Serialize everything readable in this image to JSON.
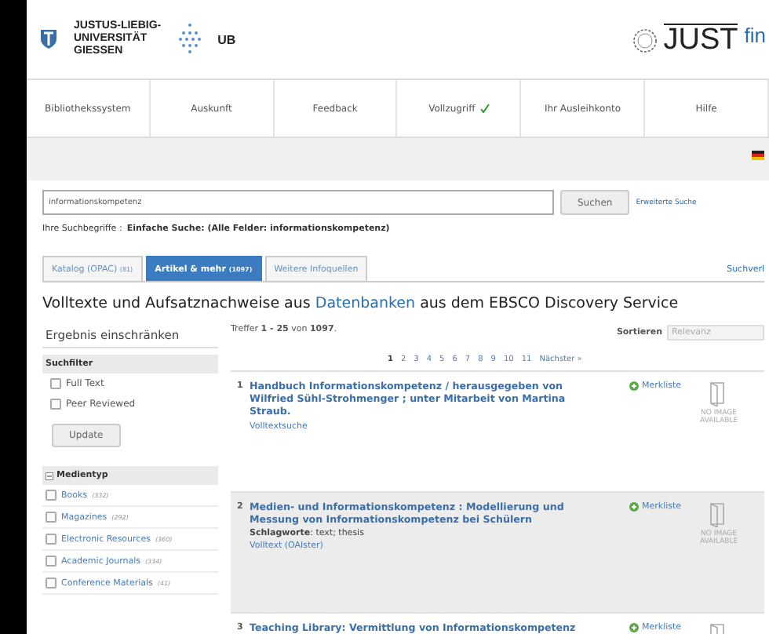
{
  "header": {
    "university": [
      "JUSTUS-LIEBIG-",
      "UNIVERSITÄT",
      "GIESSEN"
    ],
    "library": "UB",
    "brand": "JUST",
    "brand_suffix": "fin"
  },
  "nav": [
    {
      "label": "Bibliothekssystem",
      "checked": false
    },
    {
      "label": "Auskunft",
      "checked": false
    },
    {
      "label": "Feedback",
      "checked": false
    },
    {
      "label": "Vollzugriff",
      "checked": true
    },
    {
      "label": "Ihr Ausleihkonto",
      "checked": false
    },
    {
      "label": "Hilfe",
      "checked": false
    }
  ],
  "search": {
    "value": "informationskompetenz",
    "button": "Suchen",
    "advanced": "Erweiterte Suche"
  },
  "query": {
    "label": "Ihre Suchbegriffe :",
    "value": "Einfache Suche: (Alle Felder: informationskompetenz)"
  },
  "tabs": [
    {
      "label": "Katalog (OPAC)",
      "count": "(81)",
      "selected": false
    },
    {
      "label": "Artikel & mehr",
      "count": "(1097)",
      "selected": true
    },
    {
      "label": "Weitere Infoquellen",
      "selected": false
    }
  ],
  "history_link": "Suchverl",
  "heading": {
    "before": "Volltexte und Aufsatznachweise aus",
    "link": "Datenbanken",
    "after": "aus dem EBSCO Discovery Service"
  },
  "sidebar": {
    "title": "Ergebnis einschränken",
    "filter": {
      "title": "Suchfilter",
      "options": [
        {
          "label": "Full Text",
          "checked": false
        },
        {
          "label": "Peer Reviewed",
          "checked": false
        }
      ],
      "button": "Update"
    },
    "facet": {
      "title": "Medientyp",
      "expanded": true,
      "items": [
        {
          "label": "Books",
          "count": "(332)",
          "checked": false
        },
        {
          "label": "Magazines",
          "count": "(292)",
          "checked": false
        },
        {
          "label": "Electronic Resources",
          "count": "(360)",
          "checked": false
        },
        {
          "label": "Academic Journals",
          "count": "(334)",
          "checked": false
        },
        {
          "label": "Conference Materials",
          "count": "(41)",
          "checked": false
        }
      ]
    }
  },
  "results": {
    "summary": "Treffer **1 - 25** von **1097**.",
    "sort_label": "Sortieren",
    "sort_value": "Relevanz",
    "pages": [
      {
        "label": "1",
        "selected": true
      },
      {
        "label": "2",
        "selected": false
      },
      {
        "label": "3",
        "selected": false
      },
      {
        "label": "4",
        "selected": false
      },
      {
        "label": "5",
        "selected": false
      },
      {
        "label": "6",
        "selected": false
      },
      {
        "label": "7",
        "selected": false
      },
      {
        "label": "8",
        "selected": false
      },
      {
        "label": "9",
        "selected": false
      },
      {
        "label": "10",
        "selected": false
      },
      {
        "label": "11",
        "selected": false
      }
    ],
    "next": "Nächster »",
    "items": [
      {
        "number": "1",
        "title": "Handbuch Informationskompetenz / herausgegeben von Wilfried Sühl-Strohmenger ; unter Mitarbeit von Martina Straub.",
        "link": "Volltextsuche",
        "save": "Merkliste",
        "cover": "NO IMAGE AVAILABLE",
        "selected": false
      },
      {
        "number": "2",
        "title": "Medien- und Informationskompetenz : Modellierung und Messung von Informationskompetenz bei Schülern",
        "subjects_label": "Schlagworte",
        "subjects": ": text; thesis",
        "link": "Volltext (OAIster)",
        "save": "Merkliste",
        "cover": "NO IMAGE AVAILABLE",
        "selected": true
      },
      {
        "number": "3",
        "title": "Teaching Library: Vermittlung von Informationskompetenz",
        "save": "Merkliste",
        "selected": false
      }
    ]
  }
}
